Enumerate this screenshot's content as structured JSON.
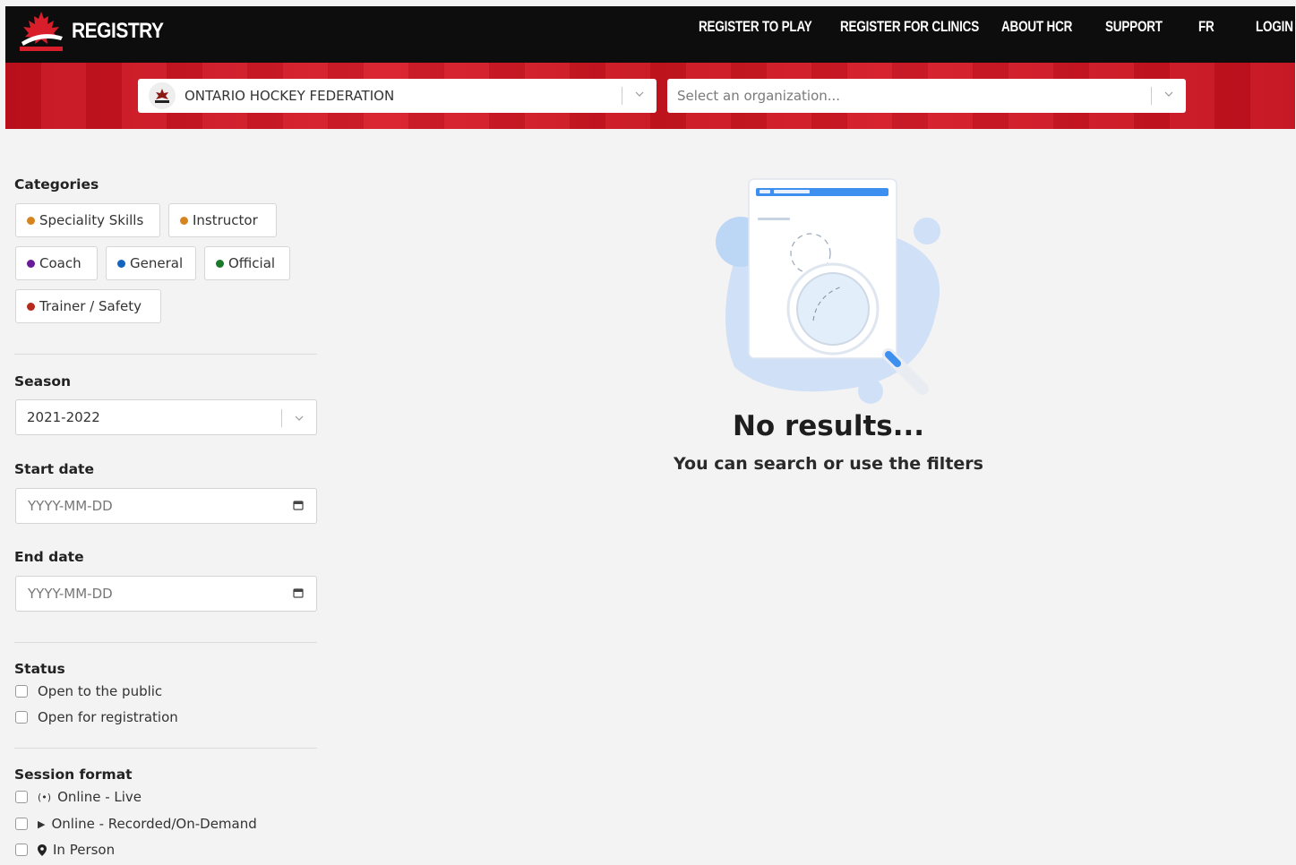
{
  "header": {
    "brand": "REGISTRY",
    "nav": [
      "REGISTER TO PLAY",
      "REGISTER FOR CLINICS",
      "ABOUT HCR",
      "SUPPORT",
      "FR",
      "LOGIN"
    ]
  },
  "filters_bar": {
    "federation": "ONTARIO HOCKEY FEDERATION",
    "organization_placeholder": "Select an organization..."
  },
  "sidebar": {
    "categories_label": "Categories",
    "categories": [
      {
        "label": "Speciality Skills",
        "color": "#d4851f"
      },
      {
        "label": "Instructor",
        "color": "#d4851f"
      },
      {
        "label": "Coach",
        "color": "#6a1b9a"
      },
      {
        "label": "General",
        "color": "#1565c0"
      },
      {
        "label": "Official",
        "color": "#1b7a2a"
      },
      {
        "label": "Trainer / Safety",
        "color": "#b52a1c"
      }
    ],
    "season_label": "Season",
    "season_value": "2021-2022",
    "start_label": "Start date",
    "start_placeholder": "YYYY-MM-DD",
    "end_label": "End date",
    "end_placeholder": "YYYY-MM-DD",
    "status_label": "Status",
    "status_options": [
      "Open to the public",
      "Open for registration"
    ],
    "format_label": "Session format",
    "format_options": [
      {
        "label": "Online - Live",
        "icon": "broadcast-icon"
      },
      {
        "label": "Online - Recorded/On-Demand",
        "icon": "play-icon"
      },
      {
        "label": "In Person",
        "icon": "map-pin-icon"
      }
    ]
  },
  "empty_state": {
    "title": "No results...",
    "subtitle": "You can search or use the filters"
  }
}
